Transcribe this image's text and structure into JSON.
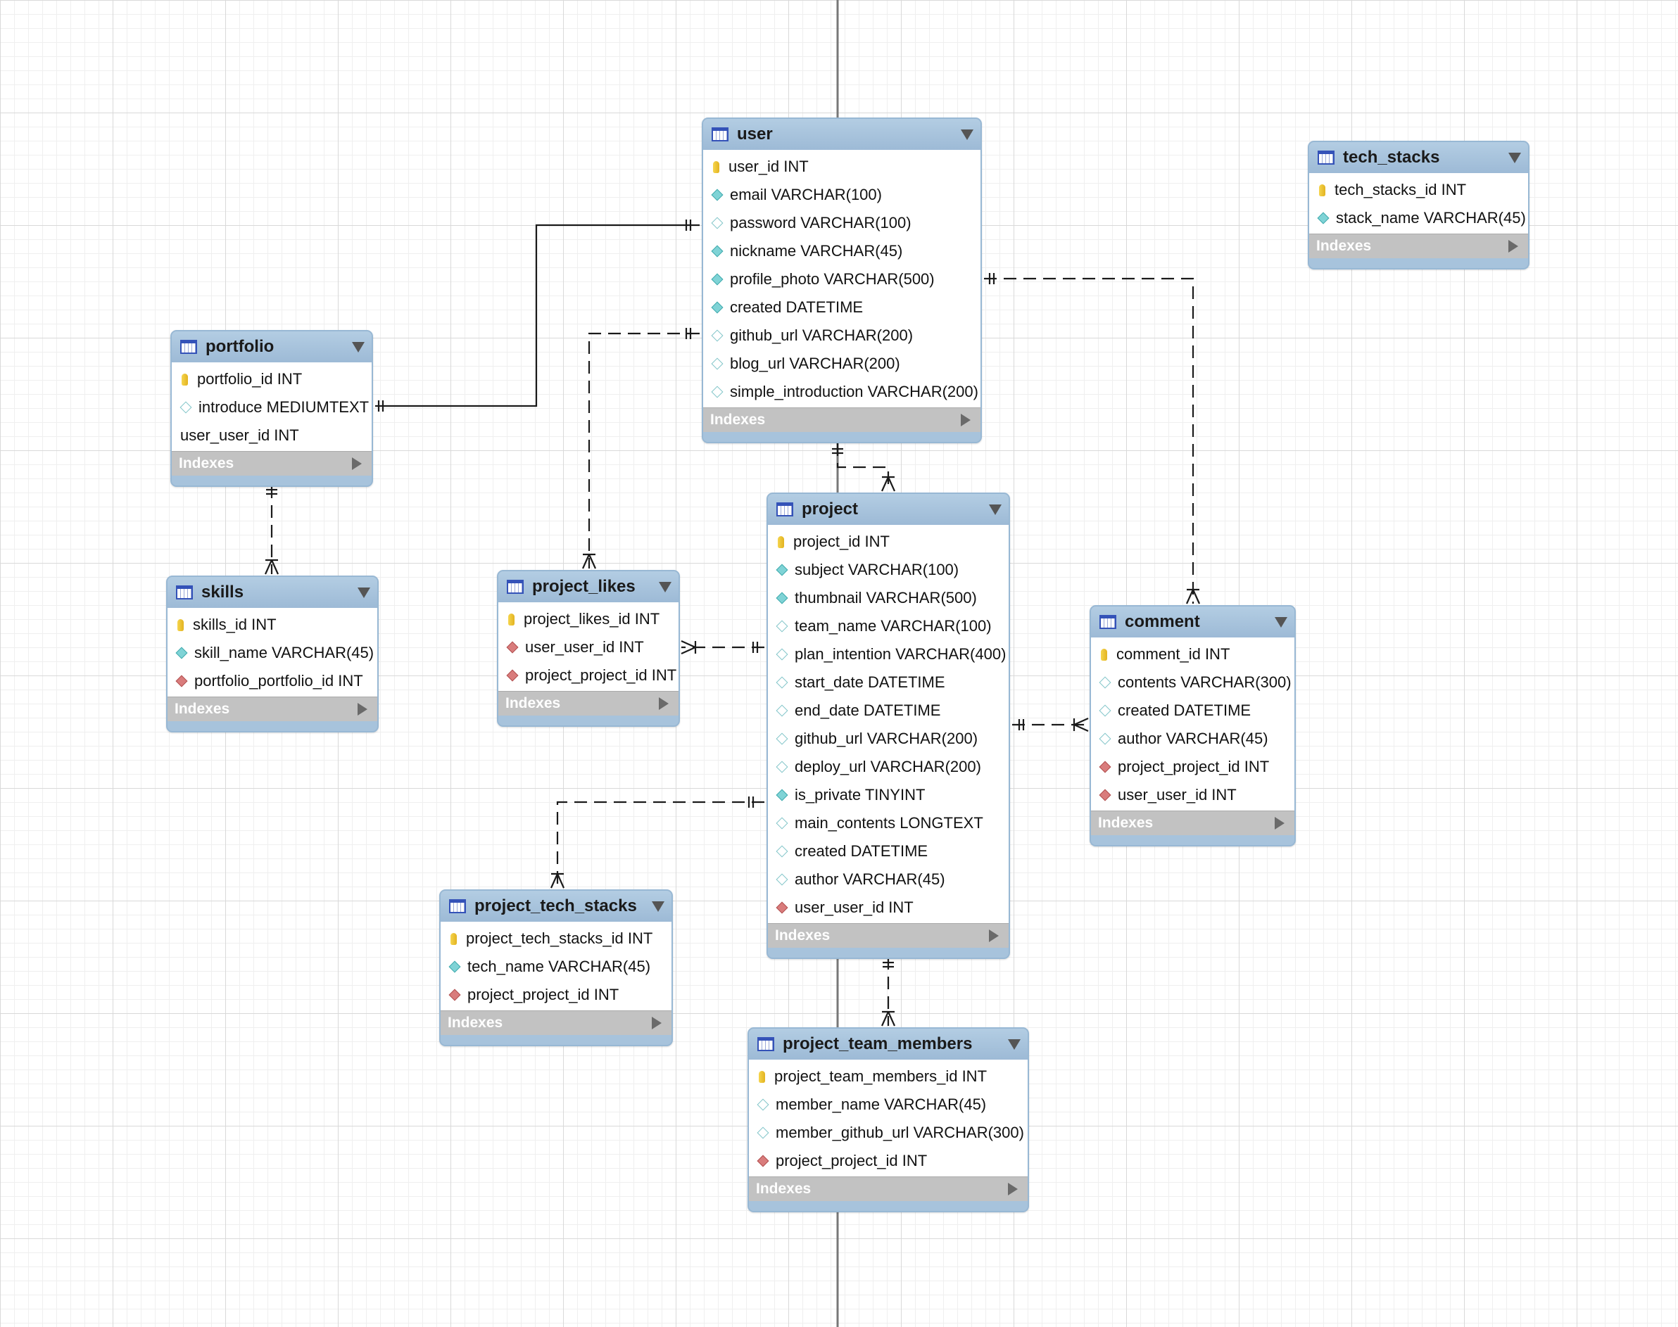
{
  "diagram": {
    "tables": [
      {
        "key": "user",
        "name": "user",
        "columns": [
          {
            "icon": "key",
            "text": "user_id INT"
          },
          {
            "icon": "nn",
            "text": "email VARCHAR(100)"
          },
          {
            "icon": "null",
            "text": "password VARCHAR(100)"
          },
          {
            "icon": "nn",
            "text": "nickname VARCHAR(45)"
          },
          {
            "icon": "nn",
            "text": "profile_photo VARCHAR(500)"
          },
          {
            "icon": "nn",
            "text": "created DATETIME"
          },
          {
            "icon": "null",
            "text": "github_url VARCHAR(200)"
          },
          {
            "icon": "null",
            "text": "blog_url VARCHAR(200)"
          },
          {
            "icon": "null",
            "text": "simple_introduction VARCHAR(200)"
          }
        ],
        "indexes_label": "Indexes"
      },
      {
        "key": "tech_stacks",
        "name": "tech_stacks",
        "columns": [
          {
            "icon": "key",
            "text": "tech_stacks_id INT"
          },
          {
            "icon": "nn",
            "text": "stack_name VARCHAR(45)"
          }
        ],
        "indexes_label": "Indexes"
      },
      {
        "key": "portfolio",
        "name": "portfolio",
        "columns": [
          {
            "icon": "key",
            "text": "portfolio_id INT"
          },
          {
            "icon": "null",
            "text": "introduce MEDIUMTEXT"
          },
          {
            "icon": "blank",
            "text": "user_user_id INT"
          }
        ],
        "indexes_label": "Indexes"
      },
      {
        "key": "skills",
        "name": "skills",
        "columns": [
          {
            "icon": "key",
            "text": "skills_id INT"
          },
          {
            "icon": "nn",
            "text": "skill_name VARCHAR(45)"
          },
          {
            "icon": "fk",
            "text": "portfolio_portfolio_id INT"
          }
        ],
        "indexes_label": "Indexes"
      },
      {
        "key": "project_likes",
        "name": "project_likes",
        "columns": [
          {
            "icon": "key",
            "text": "project_likes_id INT"
          },
          {
            "icon": "fk",
            "text": "user_user_id INT"
          },
          {
            "icon": "fk",
            "text": "project_project_id INT"
          }
        ],
        "indexes_label": "Indexes"
      },
      {
        "key": "project",
        "name": "project",
        "columns": [
          {
            "icon": "key",
            "text": "project_id INT"
          },
          {
            "icon": "nn",
            "text": "subject VARCHAR(100)"
          },
          {
            "icon": "nn",
            "text": "thumbnail VARCHAR(500)"
          },
          {
            "icon": "null",
            "text": "team_name VARCHAR(100)"
          },
          {
            "icon": "null",
            "text": "plan_intention VARCHAR(400)"
          },
          {
            "icon": "null",
            "text": "start_date DATETIME"
          },
          {
            "icon": "null",
            "text": "end_date DATETIME"
          },
          {
            "icon": "null",
            "text": "github_url VARCHAR(200)"
          },
          {
            "icon": "null",
            "text": "deploy_url VARCHAR(200)"
          },
          {
            "icon": "nn",
            "text": "is_private TINYINT"
          },
          {
            "icon": "null",
            "text": "main_contents LONGTEXT"
          },
          {
            "icon": "null",
            "text": "created DATETIME"
          },
          {
            "icon": "null",
            "text": "author VARCHAR(45)"
          },
          {
            "icon": "fk",
            "text": "user_user_id INT"
          }
        ],
        "indexes_label": "Indexes"
      },
      {
        "key": "comment",
        "name": "comment",
        "columns": [
          {
            "icon": "key",
            "text": "comment_id INT"
          },
          {
            "icon": "null",
            "text": "contents VARCHAR(300)"
          },
          {
            "icon": "null",
            "text": "created DATETIME"
          },
          {
            "icon": "null",
            "text": "author VARCHAR(45)"
          },
          {
            "icon": "fk",
            "text": "project_project_id INT"
          },
          {
            "icon": "fk",
            "text": "user_user_id INT"
          }
        ],
        "indexes_label": "Indexes"
      },
      {
        "key": "project_tech_stacks",
        "name": "project_tech_stacks",
        "columns": [
          {
            "icon": "key",
            "text": "project_tech_stacks_id INT"
          },
          {
            "icon": "nn",
            "text": "tech_name VARCHAR(45)"
          },
          {
            "icon": "fk",
            "text": "project_project_id INT"
          }
        ],
        "indexes_label": "Indexes"
      },
      {
        "key": "project_team_members",
        "name": "project_team_members",
        "columns": [
          {
            "icon": "key",
            "text": "project_team_members_id INT"
          },
          {
            "icon": "null",
            "text": "member_name VARCHAR(45)"
          },
          {
            "icon": "null",
            "text": "member_github_url VARCHAR(300)"
          },
          {
            "icon": "fk",
            "text": "project_project_id INT"
          }
        ],
        "indexes_label": "Indexes"
      }
    ],
    "relationships": [
      {
        "from": "user",
        "to": "portfolio",
        "style": "solid",
        "cardinality": "one-to-one"
      },
      {
        "from": "user",
        "to": "project_likes",
        "style": "dashed",
        "cardinality": "one-to-many"
      },
      {
        "from": "user",
        "to": "project",
        "style": "dashed",
        "cardinality": "one-to-many"
      },
      {
        "from": "user",
        "to": "comment",
        "style": "dashed",
        "cardinality": "one-to-many"
      },
      {
        "from": "portfolio",
        "to": "skills",
        "style": "dashed",
        "cardinality": "one-to-many"
      },
      {
        "from": "project",
        "to": "project_likes",
        "style": "dashed",
        "cardinality": "one-to-many"
      },
      {
        "from": "project",
        "to": "comment",
        "style": "dashed",
        "cardinality": "one-to-many"
      },
      {
        "from": "project",
        "to": "project_tech_stacks",
        "style": "dashed",
        "cardinality": "one-to-many"
      },
      {
        "from": "project",
        "to": "project_team_members",
        "style": "dashed",
        "cardinality": "one-to-many"
      }
    ]
  }
}
